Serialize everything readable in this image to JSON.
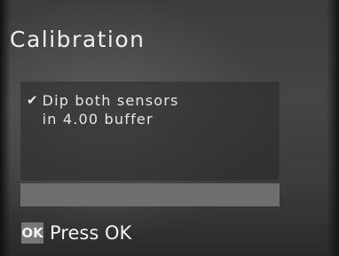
{
  "screen": {
    "title": "Calibration"
  },
  "message": {
    "check_icon": "check-icon",
    "line1": "Dip both sensors",
    "line2": "in 4.00 buffer"
  },
  "progress": {
    "fraction": 0
  },
  "footer": {
    "ok_key": "OK",
    "ok_label": "Press OK"
  },
  "colors": {
    "background": "#3c3c3c",
    "panel": "#2a2a2a",
    "progress_track": "#6e6e6e",
    "ok_badge": "#767676",
    "text": "#f0f0f0"
  }
}
